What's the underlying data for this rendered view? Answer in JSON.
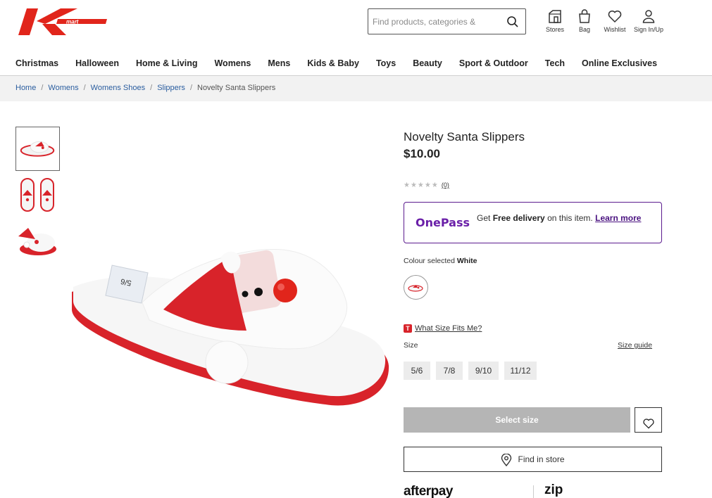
{
  "header": {
    "logo_text": "kmart",
    "search_placeholder": "Find products, categories &",
    "utilities": [
      {
        "label": "Stores",
        "icon": "store-icon"
      },
      {
        "label": "Bag",
        "icon": "bag-icon"
      },
      {
        "label": "Wishlist",
        "icon": "heart-icon"
      },
      {
        "label": "Sign In/Up",
        "icon": "user-icon"
      }
    ]
  },
  "nav": [
    "Christmas",
    "Halloween",
    "Home & Living",
    "Womens",
    "Mens",
    "Kids & Baby",
    "Toys",
    "Beauty",
    "Sport & Outdoor",
    "Tech",
    "Online Exclusives"
  ],
  "breadcrumb": [
    "Home",
    "Womens",
    "Womens Shoes",
    "Slippers",
    "Novelty Santa Slippers"
  ],
  "product": {
    "title": "Novelty Santa Slippers",
    "price": "$10.00",
    "rating_stars": "★★★★★",
    "rating_count": "(0)",
    "label_tag_text": "5/6"
  },
  "onepass": {
    "brand": "OnePass",
    "text_prefix": "Get ",
    "text_bold": "Free delivery",
    "text_suffix": " on this item. ",
    "link": "Learn more"
  },
  "colour": {
    "label": "Colour selected",
    "value": "White"
  },
  "size": {
    "fit_badge": "T",
    "fit_link": "What Size Fits Me?",
    "label": "Size",
    "guide_link": "Size guide",
    "options": [
      "5/6",
      "7/8",
      "9/10",
      "11/12"
    ]
  },
  "actions": {
    "select_size": "Select size",
    "find_in_store": "Find in store"
  },
  "payments": {
    "afterpay": "afterpay",
    "zip": "zip"
  },
  "colors": {
    "brand_red": "#e1251b",
    "onepass_purple": "#5b1b8e",
    "link_blue": "#2a5d9f",
    "disabled_grey": "#b5b5b5"
  }
}
